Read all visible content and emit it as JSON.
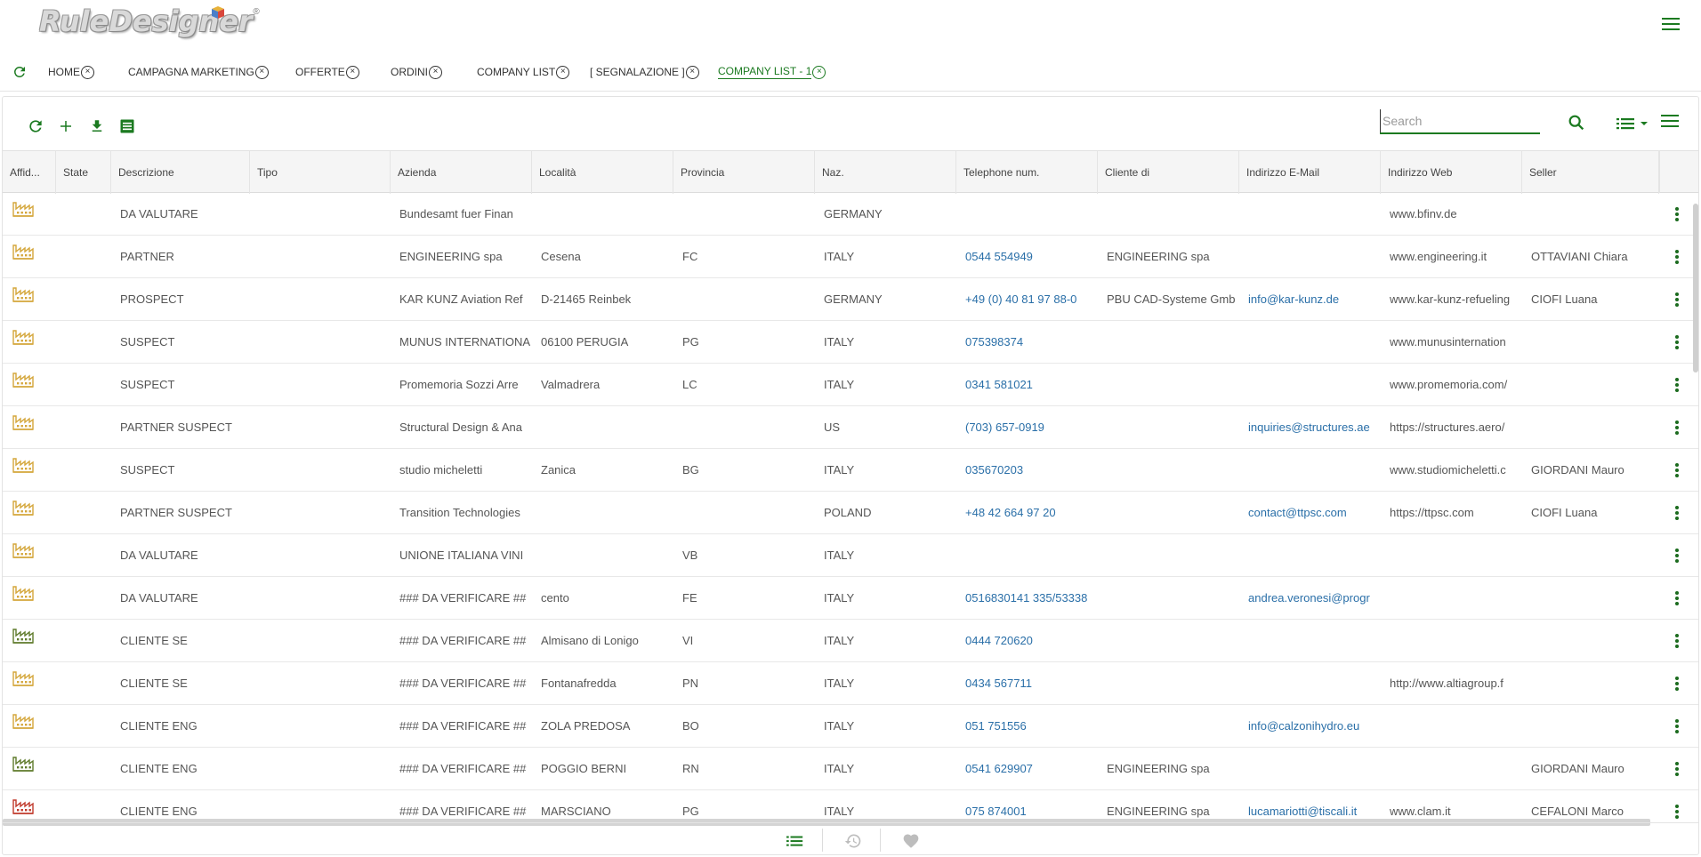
{
  "app": {
    "logo_text": "RuleDesigner",
    "logo_reg": "®"
  },
  "tabs": [
    {
      "label": "HOME",
      "active": false
    },
    {
      "label": "CAMPAGNA MARKETING",
      "active": false
    },
    {
      "label": "OFFERTE",
      "active": false
    },
    {
      "label": "ORDINI",
      "active": false
    },
    {
      "label": "COMPANY LIST",
      "active": false
    },
    {
      "label": "[ SEGNALAZIONE ]",
      "active": false
    },
    {
      "label": "COMPANY LIST - 1",
      "active": true
    }
  ],
  "search": {
    "placeholder": "Search",
    "value": ""
  },
  "columns": [
    "Affid...",
    "State",
    "Descrizione",
    "Tipo",
    "Azienda",
    "Località",
    "Provincia",
    "Naz.",
    "Telephone num.",
    "Cliente di",
    "Indirizzo E-Mail",
    "Indirizzo Web",
    "Seller"
  ],
  "rows": [
    {
      "icon": "yellow",
      "descrizione": "DA VALUTARE",
      "tipo": "",
      "azienda": "Bundesamt fuer Finan",
      "localita": "",
      "provincia": "",
      "naz": "GERMANY",
      "tel": "",
      "cliente_di": "",
      "email": "",
      "web": "www.bfinv.de",
      "seller": ""
    },
    {
      "icon": "yellow",
      "descrizione": "PARTNER",
      "tipo": "",
      "azienda": "ENGINEERING spa",
      "localita": "Cesena",
      "provincia": "FC",
      "naz": "ITALY",
      "tel": "0544 554949",
      "cliente_di": "ENGINEERING spa",
      "email": "",
      "web": "www.engineering.it",
      "seller": "OTTAVIANI Chiara"
    },
    {
      "icon": "yellow",
      "descrizione": "PROSPECT",
      "tipo": "",
      "azienda": "KAR KUNZ Aviation Ref",
      "localita": "D-21465 Reinbek",
      "provincia": "",
      "naz": "GERMANY",
      "tel": "+49 (0) 40 81 97 88-0",
      "cliente_di": "PBU CAD-Systeme Gmb",
      "email": "info@kar-kunz.de",
      "web": "www.kar-kunz-refueling",
      "seller": "CIOFI Luana"
    },
    {
      "icon": "yellow",
      "descrizione": "SUSPECT",
      "tipo": "",
      "azienda": "MUNUS INTERNATIONA",
      "localita": "06100 PERUGIA",
      "provincia": "PG",
      "naz": "ITALY",
      "tel": "075398374",
      "cliente_di": "",
      "email": "",
      "web": "www.munusinternation",
      "seller": ""
    },
    {
      "icon": "yellow",
      "descrizione": "SUSPECT",
      "tipo": "",
      "azienda": "Promemoria Sozzi Arre",
      "localita": "Valmadrera",
      "provincia": "LC",
      "naz": "ITALY",
      "tel": "0341 581021",
      "cliente_di": "",
      "email": "",
      "web": "www.promemoria.com/",
      "seller": ""
    },
    {
      "icon": "yellow",
      "descrizione": "PARTNER SUSPECT",
      "tipo": "",
      "azienda": "Structural Design & Ana",
      "localita": "",
      "provincia": "",
      "naz": "US",
      "tel": "(703) 657-0919",
      "cliente_di": "",
      "email": "inquiries@structures.ae",
      "web": "https://structures.aero/",
      "seller": ""
    },
    {
      "icon": "yellow",
      "descrizione": "SUSPECT",
      "tipo": "",
      "azienda": "studio micheletti",
      "localita": "Zanica",
      "provincia": "BG",
      "naz": "ITALY",
      "tel": "035670203",
      "cliente_di": "",
      "email": "",
      "web": "www.studiomicheletti.c",
      "seller": "GIORDANI Mauro"
    },
    {
      "icon": "yellow",
      "descrizione": "PARTNER SUSPECT",
      "tipo": "",
      "azienda": "Transition Technologies",
      "localita": "",
      "provincia": "",
      "naz": "POLAND",
      "tel": "+48 42 664 97 20",
      "cliente_di": "",
      "email": "contact@ttpsc.com",
      "web": "https://ttpsc.com",
      "seller": "CIOFI Luana"
    },
    {
      "icon": "yellow",
      "descrizione": "DA VALUTARE",
      "tipo": "",
      "azienda": "UNIONE ITALIANA VINI",
      "localita": "",
      "provincia": "VB",
      "naz": "ITALY",
      "tel": "",
      "cliente_di": "",
      "email": "",
      "web": "",
      "seller": ""
    },
    {
      "icon": "yellow",
      "descrizione": "DA VALUTARE",
      "tipo": "",
      "azienda": "### DA VERIFICARE ##",
      "localita": "cento",
      "provincia": "FE",
      "naz": "ITALY",
      "tel": "0516830141 335/53338",
      "cliente_di": "",
      "email": "andrea.veronesi@progr",
      "web": "",
      "seller": ""
    },
    {
      "icon": "green",
      "descrizione": "CLIENTE SE",
      "tipo": "",
      "azienda": "### DA VERIFICARE ##",
      "localita": "Almisano di Lonigo",
      "provincia": "VI",
      "naz": "ITALY",
      "tel": "0444 720620",
      "cliente_di": "",
      "email": "",
      "web": "",
      "seller": ""
    },
    {
      "icon": "yellow",
      "descrizione": "CLIENTE SE",
      "tipo": "",
      "azienda": "### DA VERIFICARE ##",
      "localita": "Fontanafredda",
      "provincia": "PN",
      "naz": "ITALY",
      "tel": "0434 567711",
      "cliente_di": "",
      "email": "",
      "web": "http://www.altiagroup.f",
      "seller": ""
    },
    {
      "icon": "yellow",
      "descrizione": "CLIENTE ENG",
      "tipo": "",
      "azienda": "### DA VERIFICARE ##",
      "localita": "ZOLA PREDOSA",
      "provincia": "BO",
      "naz": "ITALY",
      "tel": "051 751556",
      "cliente_di": "",
      "email": "info@calzonihydro.eu",
      "web": "",
      "seller": ""
    },
    {
      "icon": "green",
      "descrizione": "CLIENTE ENG",
      "tipo": "",
      "azienda": "### DA VERIFICARE ##",
      "localita": "POGGIO BERNI",
      "provincia": "RN",
      "naz": "ITALY",
      "tel": "0541 629907",
      "cliente_di": "ENGINEERING spa",
      "email": "",
      "web": "",
      "seller": "GIORDANI Mauro"
    },
    {
      "icon": "red",
      "descrizione": "CLIENTE ENG",
      "tipo": "",
      "azienda": "### DA VERIFICARE ##",
      "localita": "MARSCIANO",
      "provincia": "PG",
      "naz": "ITALY",
      "tel": "075 874001",
      "cliente_di": "ENGINEERING spa",
      "email": "lucamariotti@tiscali.it",
      "web": "www.clam.it",
      "seller": "CEFALONI Marco"
    }
  ],
  "colors": {
    "accent": "#1b7a20",
    "link": "#2a6fa8",
    "icon_yellow": "#d4a63a",
    "icon_green": "#5e7a2a",
    "icon_red": "#c0392b"
  },
  "icons": {
    "toolbar": [
      "refresh-icon",
      "add-icon",
      "download-icon",
      "list-document-icon"
    ],
    "footer": [
      "list-icon",
      "history-icon",
      "heart-icon"
    ]
  }
}
